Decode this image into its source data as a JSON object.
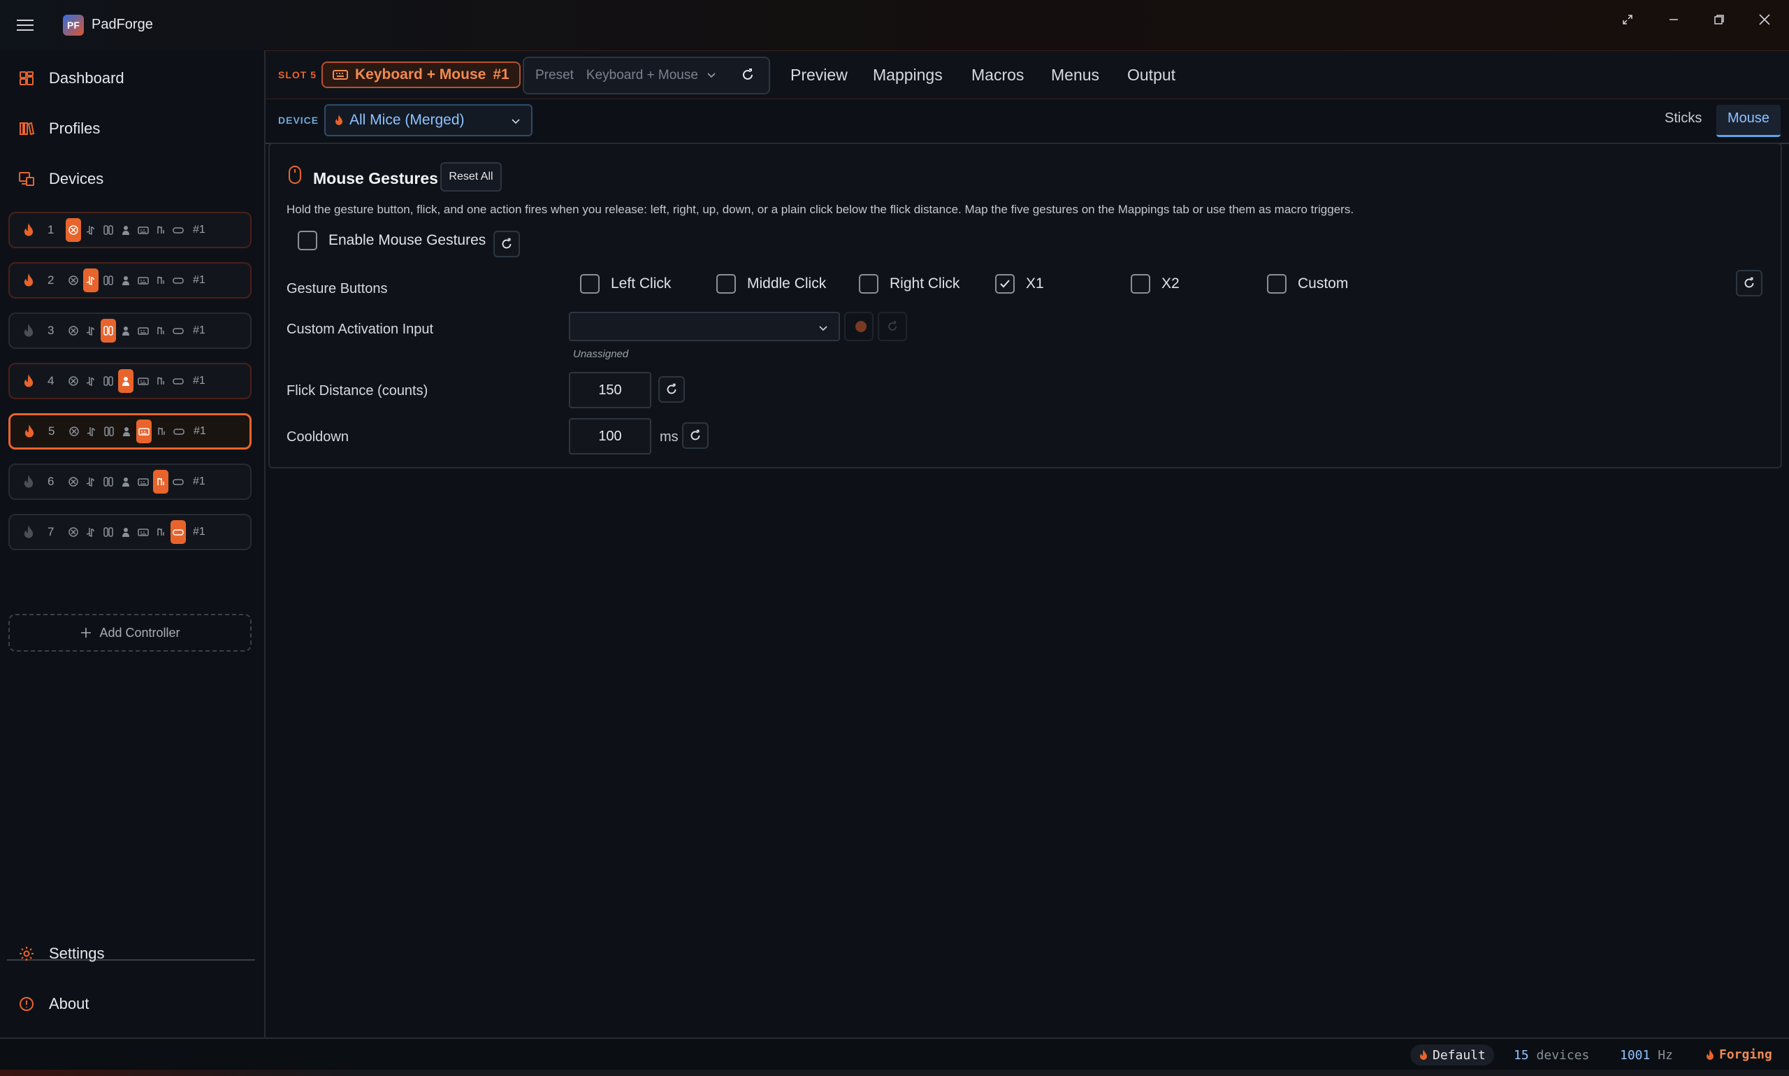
{
  "app": {
    "title": "PadForge",
    "logo_text": "PF"
  },
  "sidebar": {
    "nav": [
      {
        "label": "Dashboard",
        "icon": "dashboard-icon"
      },
      {
        "label": "Profiles",
        "icon": "profiles-icon"
      },
      {
        "label": "Devices",
        "icon": "devices-icon"
      }
    ],
    "slots": [
      {
        "num": "1",
        "tag": "#1",
        "active_type": 0,
        "enabled": true
      },
      {
        "num": "2",
        "tag": "#1",
        "active_type": 1,
        "enabled": true
      },
      {
        "num": "3",
        "tag": "#1",
        "active_type": 2,
        "enabled": false
      },
      {
        "num": "4",
        "tag": "#1",
        "active_type": 3,
        "enabled": true
      },
      {
        "num": "5",
        "tag": "#1",
        "active_type": 4,
        "enabled": true,
        "selected": true
      },
      {
        "num": "6",
        "tag": "#1",
        "active_type": 5,
        "enabled": false
      },
      {
        "num": "7",
        "tag": "#1",
        "active_type": 6,
        "enabled": false
      }
    ],
    "add_controller": "Add Controller",
    "bottom_nav": [
      {
        "label": "Settings",
        "icon": "settings-icon"
      },
      {
        "label": "About",
        "icon": "info-icon"
      }
    ]
  },
  "topbar": {
    "slot_label": "SLOT 5",
    "controller_name": "Keyboard + Mouse",
    "controller_tag": "#1",
    "preset_label": "Preset",
    "preset_value": "Keyboard + Mouse",
    "tabs": [
      "Preview",
      "Mappings",
      "Macros",
      "Menus",
      "Output"
    ]
  },
  "devicebar": {
    "label": "DEVICE",
    "selected_device": "All Mice (Merged)",
    "subtabs": [
      "Sticks",
      "Mouse"
    ],
    "active_subtab": "Mouse"
  },
  "gestures": {
    "title": "Mouse Gestures",
    "reset_all": "Reset All",
    "description": "Hold the gesture button, flick, and one action fires when you release: left, right, up, down, or a plain click below the flick distance. Map the five gestures on the Mappings tab or use them as macro triggers.",
    "enable_label": "Enable Mouse Gestures",
    "enable_checked": false,
    "gesture_buttons_label": "Gesture Buttons",
    "buttons": [
      {
        "label": "Left Click",
        "checked": false
      },
      {
        "label": "Middle Click",
        "checked": false
      },
      {
        "label": "Right Click",
        "checked": false
      },
      {
        "label": "X1",
        "checked": true
      },
      {
        "label": "X2",
        "checked": false
      },
      {
        "label": "Custom",
        "checked": false
      }
    ],
    "custom_input_label": "Custom Activation Input",
    "custom_input_value": "",
    "custom_input_status": "Unassigned",
    "flick_label": "Flick Distance (counts)",
    "flick_value": "150",
    "cooldown_label": "Cooldown",
    "cooldown_value": "100",
    "cooldown_unit": "ms"
  },
  "status": {
    "profile": "Default",
    "devices_count": "15",
    "devices_label": "devices",
    "rate": "1001",
    "rate_unit": "Hz",
    "state": "Forging"
  },
  "colors": {
    "accent": "#e8642c",
    "blue": "#8fc3ff",
    "bg": "#0d1117"
  }
}
